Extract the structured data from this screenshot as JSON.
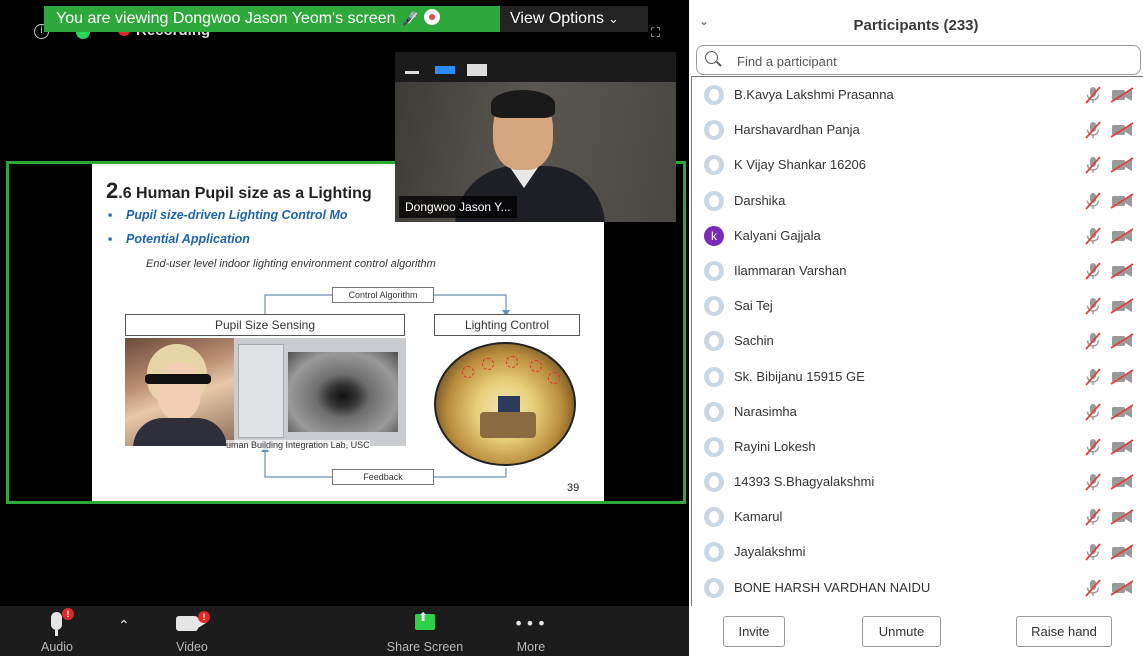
{
  "meeting": {
    "banner_text": "You are viewing Dongwoo Jason Yeom's screen",
    "view_options_label": "View Options",
    "recording_label": "Recording",
    "speaker_name": "Dongwoo Jason Y...",
    "slide": {
      "title_num": "2",
      "title_rest": ".6 Human Pupil size as a Lighting",
      "bullet1": "Pupil size-driven Lighting Control Mo",
      "bullet2": "Potential Application",
      "description": "End-user level indoor lighting environment control algorithm",
      "box_pupil": "Pupil Size Sensing",
      "box_lighting": "Lighting Control",
      "control_algorithm": "Control Algorithm",
      "feedback": "Feedback",
      "caption": "uman Building Integration Lab, USC",
      "page_number": "39"
    },
    "controls": {
      "audio_label": "Audio",
      "audio_badge": "!",
      "video_label": "Video",
      "video_badge": "!",
      "share_label": "Share Screen",
      "more_label": "More"
    },
    "colors": {
      "share_border": "#2fa83b",
      "share_button": "#2fd14b",
      "alert_badge": "#e02828",
      "recording_dot": "#e02828"
    }
  },
  "panel": {
    "title": "Participants (233)",
    "search_placeholder": "Find a participant",
    "participants": [
      {
        "name": "B.Kavya Lakshmi Prasanna",
        "initial": ""
      },
      {
        "name": "Harshavardhan Panja",
        "initial": ""
      },
      {
        "name": "K Vijay Shankar 16206",
        "initial": ""
      },
      {
        "name": "Darshika",
        "initial": ""
      },
      {
        "name": "Kalyani Gajjala",
        "initial": "k"
      },
      {
        "name": "Ilammaran Varshan",
        "initial": ""
      },
      {
        "name": "Sai Tej",
        "initial": ""
      },
      {
        "name": "Sachin",
        "initial": ""
      },
      {
        "name": "Sk. Bibijanu 15915 GE",
        "initial": ""
      },
      {
        "name": "Narasimha",
        "initial": ""
      },
      {
        "name": "Rayini Lokesh",
        "initial": ""
      },
      {
        "name": "14393 S.Bhagyalakshmi",
        "initial": ""
      },
      {
        "name": "Kamarul",
        "initial": ""
      },
      {
        "name": "Jayalakshmi",
        "initial": ""
      },
      {
        "name": "BONE HARSH VARDHAN NAIDU",
        "initial": ""
      }
    ],
    "buttons": {
      "invite": "Invite",
      "unmute": "Unmute",
      "raise_hand": "Raise hand"
    }
  }
}
